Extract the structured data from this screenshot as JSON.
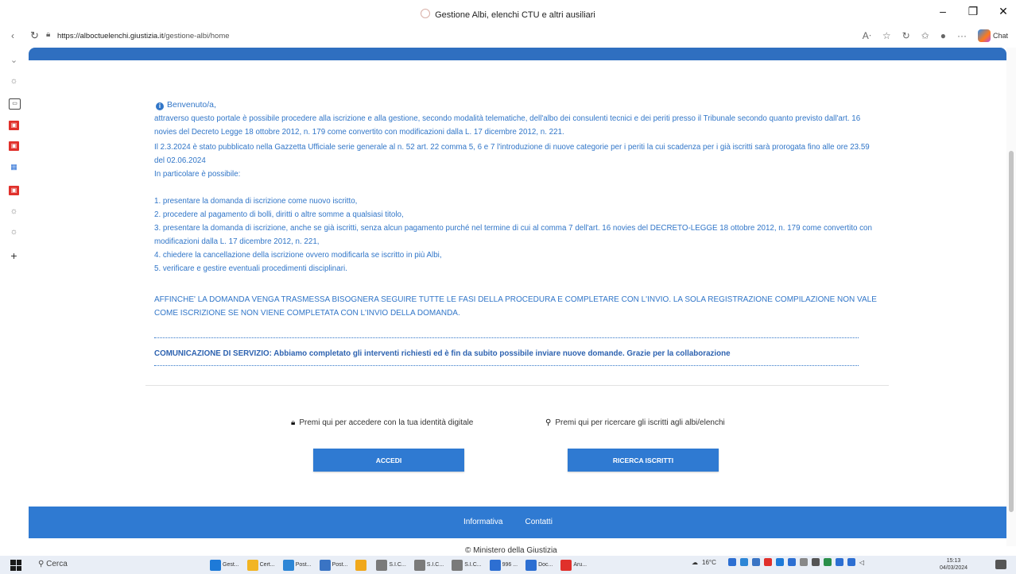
{
  "browser": {
    "tab_title": "Gestione Albi, elenchi CTU e altri ausiliari",
    "url_domain": "https://alboctuelenchi.giustizia.it",
    "url_path": "/gestione-albi/home",
    "chat_label": "Chat",
    "window_controls": [
      "minimize-icon",
      "restore-icon",
      "close-icon"
    ]
  },
  "sidebar": {
    "icons": [
      "chevron-down-icon",
      "gear-icon",
      "calendar-icon",
      "app-red-icon",
      "app-red-icon",
      "app-blue-icon",
      "app-red-icon",
      "gear-icon",
      "gear-icon",
      "plus-icon"
    ]
  },
  "main": {
    "welcome": "Benvenuto/a,",
    "intro": "attraverso questo portale è possibile procedere alla iscrizione e alla gestione, secondo modalità telematiche, dell'albo dei consulenti tecnici e dei periti presso il Tribunale secondo quanto previsto dall'art. 16 novies del Decreto Legge 18 ottobre 2012, n. 179 come convertito con modificazioni dalla L. 17 dicembre 2012, n. 221.",
    "notice": "Il 2.3.2024 è stato pubblicato nella Gazzetta Ufficiale serie generale al n. 52 art. 22 comma 5, 6 e 7 l'introduzione di nuove categorie per i periti la cui scadenza per i già iscritti sarà prorogata fino alle ore 23.59 del 02.06.2024",
    "particolare": "In particolare è possibile:",
    "items": [
      "1. presentare la domanda di iscrizione come nuovo iscritto,",
      "2. procedere al pagamento di bolli, diritti o altre somme a qualsiasi titolo,",
      "3. presentare la domanda di iscrizione, anche se già iscritti, senza alcun pagamento purché nel termine di cui al comma 7 dell'art. 16 novies del DECRETO-LEGGE 18 ottobre 2012, n. 179 come convertito con modificazioni dalla L. 17 dicembre 2012, n. 221,",
      "4. chiedere la cancellazione della iscrizione ovvero modificarla se iscritto in più Albi,",
      "5. verificare e gestire eventuali procedimenti disciplinari."
    ],
    "warning": "AFFINCHE' LA DOMANDA VENGA TRASMESSA BISOGNERA SEGUIRE TUTTE LE FASI DELLA PROCEDURA E COMPLETARE CON L'INVIO. LA SOLA REGISTRAZIONE COMPILAZIONE NON VALE COME ISCRIZIONE SE NON VIENE COMPLETATA CON L'INVIO DELLA DOMANDA.",
    "service_notice": "COMUNICAZIONE DI SERVIZIO: Abbiamo completato gli interventi richiesti ed è fin da subito possibile inviare nuove domande. Grazie per la collaborazione"
  },
  "actions": {
    "login_label": "Premi qui per accedere con la tua identità digitale",
    "login_button": "ACCEDI",
    "search_label": "Premi qui per ricercare gli iscritti agli albi/elenchi",
    "search_button": "RICERCA ISCRITTI"
  },
  "footer": {
    "links": [
      "Informativa",
      "Contatti"
    ],
    "ministero": "© Ministero della Giustizia"
  },
  "taskbar": {
    "search": "Cerca",
    "apps": [
      "Gest...",
      "Cert...",
      "Post...",
      "Post...",
      "",
      "S.I.C...",
      "S.I.C...",
      "S.I.C...",
      "996 ...",
      "Doc...",
      "Aru..."
    ],
    "temperature": "16°C",
    "time": "15:13",
    "date": "04/03/2024"
  },
  "colors": {
    "primary": "#2f7ad2",
    "text_blue": "#3176c8",
    "header_bar": "#2f6fc0"
  }
}
